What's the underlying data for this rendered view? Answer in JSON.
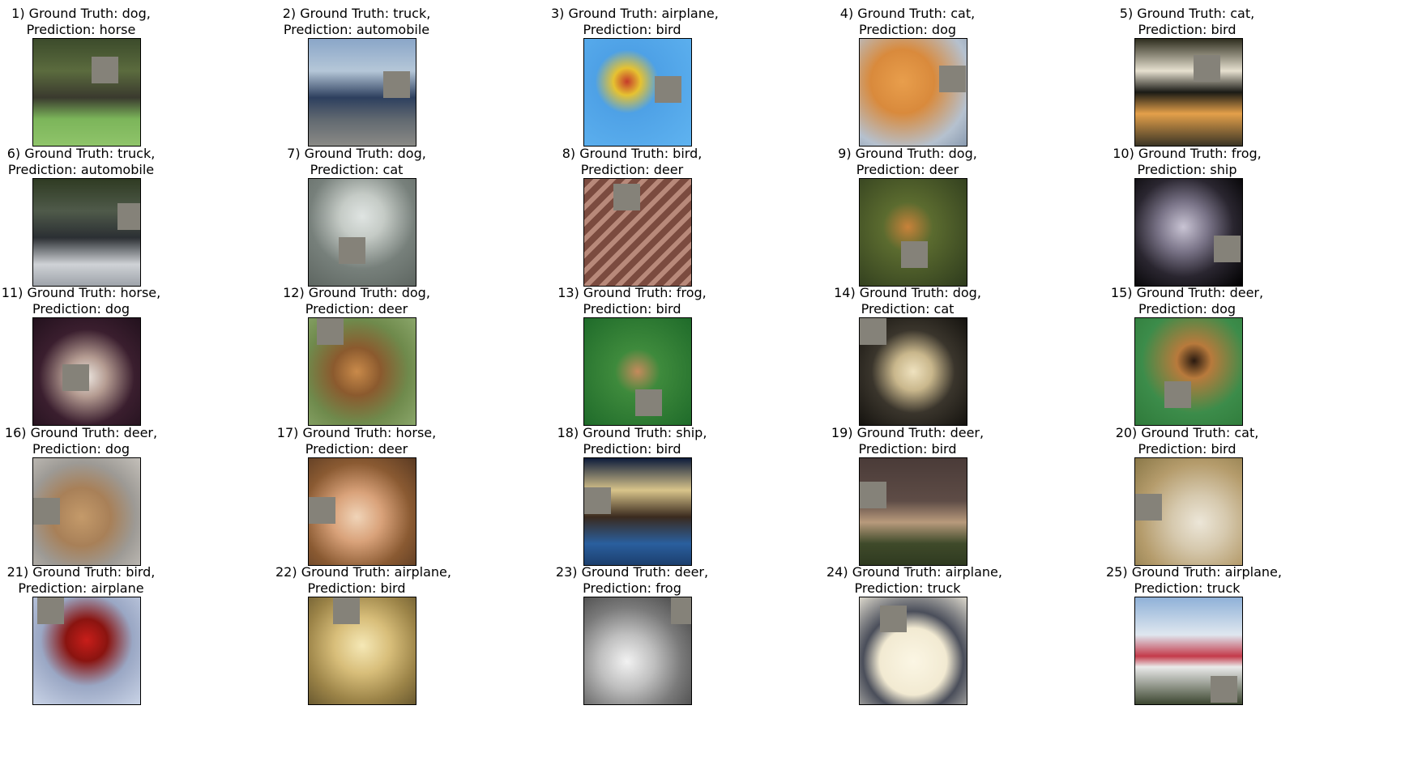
{
  "items": [
    {
      "index": "1)",
      "line1": "1) Ground Truth: dog,",
      "line2": "Prediction: horse",
      "bg": "linear-gradient(180deg,#3c4b2b 0%,#5b6b3e 30%,#3a3a2e 55%,#7cb55a 75%,#8fc46a 100%)"
    },
    {
      "index": "2)",
      "line1": "2) Ground Truth: truck,",
      "line2": "Prediction: automobile",
      "bg": "linear-gradient(180deg,#8aa6c8 0%,#b5c7d8 30%,#2d3f5e 55%,#606870 75%,#8a8a86 100%)"
    },
    {
      "index": "3)",
      "line1": "3) Ground Truth: airplane,",
      "line2": "Prediction: bird",
      "bg": "radial-gradient(circle at 40% 40%,#c53b2a 0%,#e6c231 15%,#4ea1e6 35%,#5fb3f0 100%)"
    },
    {
      "index": "4)",
      "line1": "4) Ground Truth: cat,",
      "line2": "Prediction: dog",
      "bg": "radial-gradient(circle at 40% 40%,#e89e4c 0%,#d98a3c 35%,#b5c1cf 75%,#8a9bb0 100%)"
    },
    {
      "index": "5)",
      "line1": "5) Ground Truth: cat,",
      "line2": "Prediction: bird",
      "bg": "linear-gradient(180deg,#2e2d1e 0%,#e6e0cf 30%,#1a1a15 50%,#e4a04a 70%,#3b3526 100%)"
    },
    {
      "index": "6)",
      "line1": "6) Ground Truth: truck,",
      "line2": "Prediction: automobile",
      "bg": "linear-gradient(180deg,#2f3b22 0%,#4f5a4a 30%,#2b2f33 55%,#cfd2d6 80%,#9ea3aa 100%)"
    },
    {
      "index": "7)",
      "line1": "7) Ground Truth: dog,",
      "line2": "Prediction: cat",
      "bg": "radial-gradient(circle at 50% 35%,#dfe4e2 0%,#c5cbc6 25%,#77807b 60%,#5e6661 100%)"
    },
    {
      "index": "8)",
      "line1": "8) Ground Truth: bird,",
      "line2": "Prediction: deer",
      "bg": "repeating-linear-gradient(135deg,#7b4b3f 0px,#7b4b3f 8px,#b8897a 8px,#b8897a 14px)"
    },
    {
      "index": "9)",
      "line1": "9) Ground Truth: dog,",
      "line2": "Prediction: deer",
      "bg": "radial-gradient(circle at 45% 45%,#c8823a 0%,#5b6b2f 30%,#2e3b1d 100%)"
    },
    {
      "index": "10)",
      "line1": "10) Ground Truth: frog,",
      "line2": "Prediction: ship",
      "bg": "radial-gradient(circle at 45% 45%,#c9c4d4 0%,#7a7488 30%,#2a2630 60%,#000000 100%)"
    },
    {
      "index": "11)",
      "line1": "11) Ground Truth: horse,",
      "line2": "Prediction: dog",
      "bg": "radial-gradient(circle at 50% 55%,#ece6e0 0%,#b59c92 25%,#3a1e2e 60%,#22111d 100%)"
    },
    {
      "index": "12)",
      "line1": "12) Ground Truth: dog,",
      "line2": "Prediction: deer",
      "bg": "radial-gradient(circle at 45% 50%,#c98a4a 0%,#8b5a2e 30%,#6f8a4c 65%,#8aa66a 100%)"
    },
    {
      "index": "13)",
      "line1": "13) Ground Truth: frog,",
      "line2": "Prediction: bird",
      "bg": "radial-gradient(circle at 50% 50%,#c58a5c 0%,#3e8a3c 30%,#1f6b2a 100%)"
    },
    {
      "index": "14)",
      "line1": "14) Ground Truth: dog,",
      "line2": "Prediction: cat",
      "bg": "radial-gradient(ellipse at 50% 50%,#efe2bf 0%,#c9b78c 25%,#3a352c 55%,#15130f 100%)"
    },
    {
      "index": "15)",
      "line1": "15) Ground Truth: deer,",
      "line2": "Prediction: dog",
      "bg": "radial-gradient(circle at 55% 40%,#2a1a10 0%,#b87a3c 20%,#3c8c4a 60%,#2f7a3a 100%)"
    },
    {
      "index": "16)",
      "line1": "16) Ground Truth: deer,",
      "line2": "Prediction: dog",
      "bg": "radial-gradient(circle at 45% 55%,#c49a6a 0%,#a88058 35%,#9d9a95 65%,#c4c0ba 100%)"
    },
    {
      "index": "17)",
      "line1": "17) Ground Truth: horse,",
      "line2": "Prediction: deer",
      "bg": "radial-gradient(circle at 45% 55%,#f0d4b8 0%,#d9a27a 30%,#8a5a32 65%,#5a3a22 100%)"
    },
    {
      "index": "18)",
      "line1": "18) Ground Truth: ship,",
      "line2": "Prediction: bird",
      "bg": "linear-gradient(180deg,#0d1c3b 0%,#d8c48a 30%,#3a2a1e 55%,#2a5f9e 80%,#1c3f6e 100%)"
    },
    {
      "index": "19)",
      "line1": "19) Ground Truth: deer,",
      "line2": "Prediction: bird",
      "bg": "linear-gradient(180deg,#4a3b38 0%,#5e4c46 40%,#b89a7c 60%,#3f4a2a 80%,#2f3a20 100%)"
    },
    {
      "index": "20)",
      "line1": "20) Ground Truth: cat,",
      "line2": "Prediction: bird",
      "bg": "radial-gradient(circle at 60% 60%,#ece6d8 0%,#d6c9ae 30%,#b59c6c 65%,#8a7848 100%)"
    },
    {
      "index": "21)",
      "line1": "21) Ground Truth: bird,",
      "line2": "Prediction: airplane",
      "bg": "radial-gradient(circle at 50% 40%,#c81e1a 0%,#8a1410 25%,#9aa7c4 55%,#c9d3e6 100%)"
    },
    {
      "index": "22)",
      "line1": "22) Ground Truth: airplane,",
      "line2": "Prediction: bird",
      "bg": "radial-gradient(circle at 50% 45%,#f5e8b6 0%,#d8be7a 35%,#9c8448 70%,#6a5a30 100%)"
    },
    {
      "index": "23)",
      "line1": "23) Ground Truth: deer,",
      "line2": "Prediction: frog",
      "bg": "radial-gradient(circle at 40% 60%,#f2f2f2 0%,#bfbfbf 30%,#7a7a7a 60%,#3c3c3c 100%)"
    },
    {
      "index": "24)",
      "line1": "24) Ground Truth: airplane,",
      "line2": "Prediction: truck",
      "bg": "radial-gradient(circle at 50% 60%,#fbf6e4 0%,#f2ead2 40%,#4a4e5a 60%,#dcd8cc 100%)"
    },
    {
      "index": "25)",
      "line1": "25) Ground Truth: airplane,",
      "line2": "Prediction: truck",
      "bg": "linear-gradient(180deg,#8fb1d8 0%,#dfe7ef 35%,#c43a4a 55%,#eaeaea 65%,#3c4630 100%)"
    }
  ]
}
